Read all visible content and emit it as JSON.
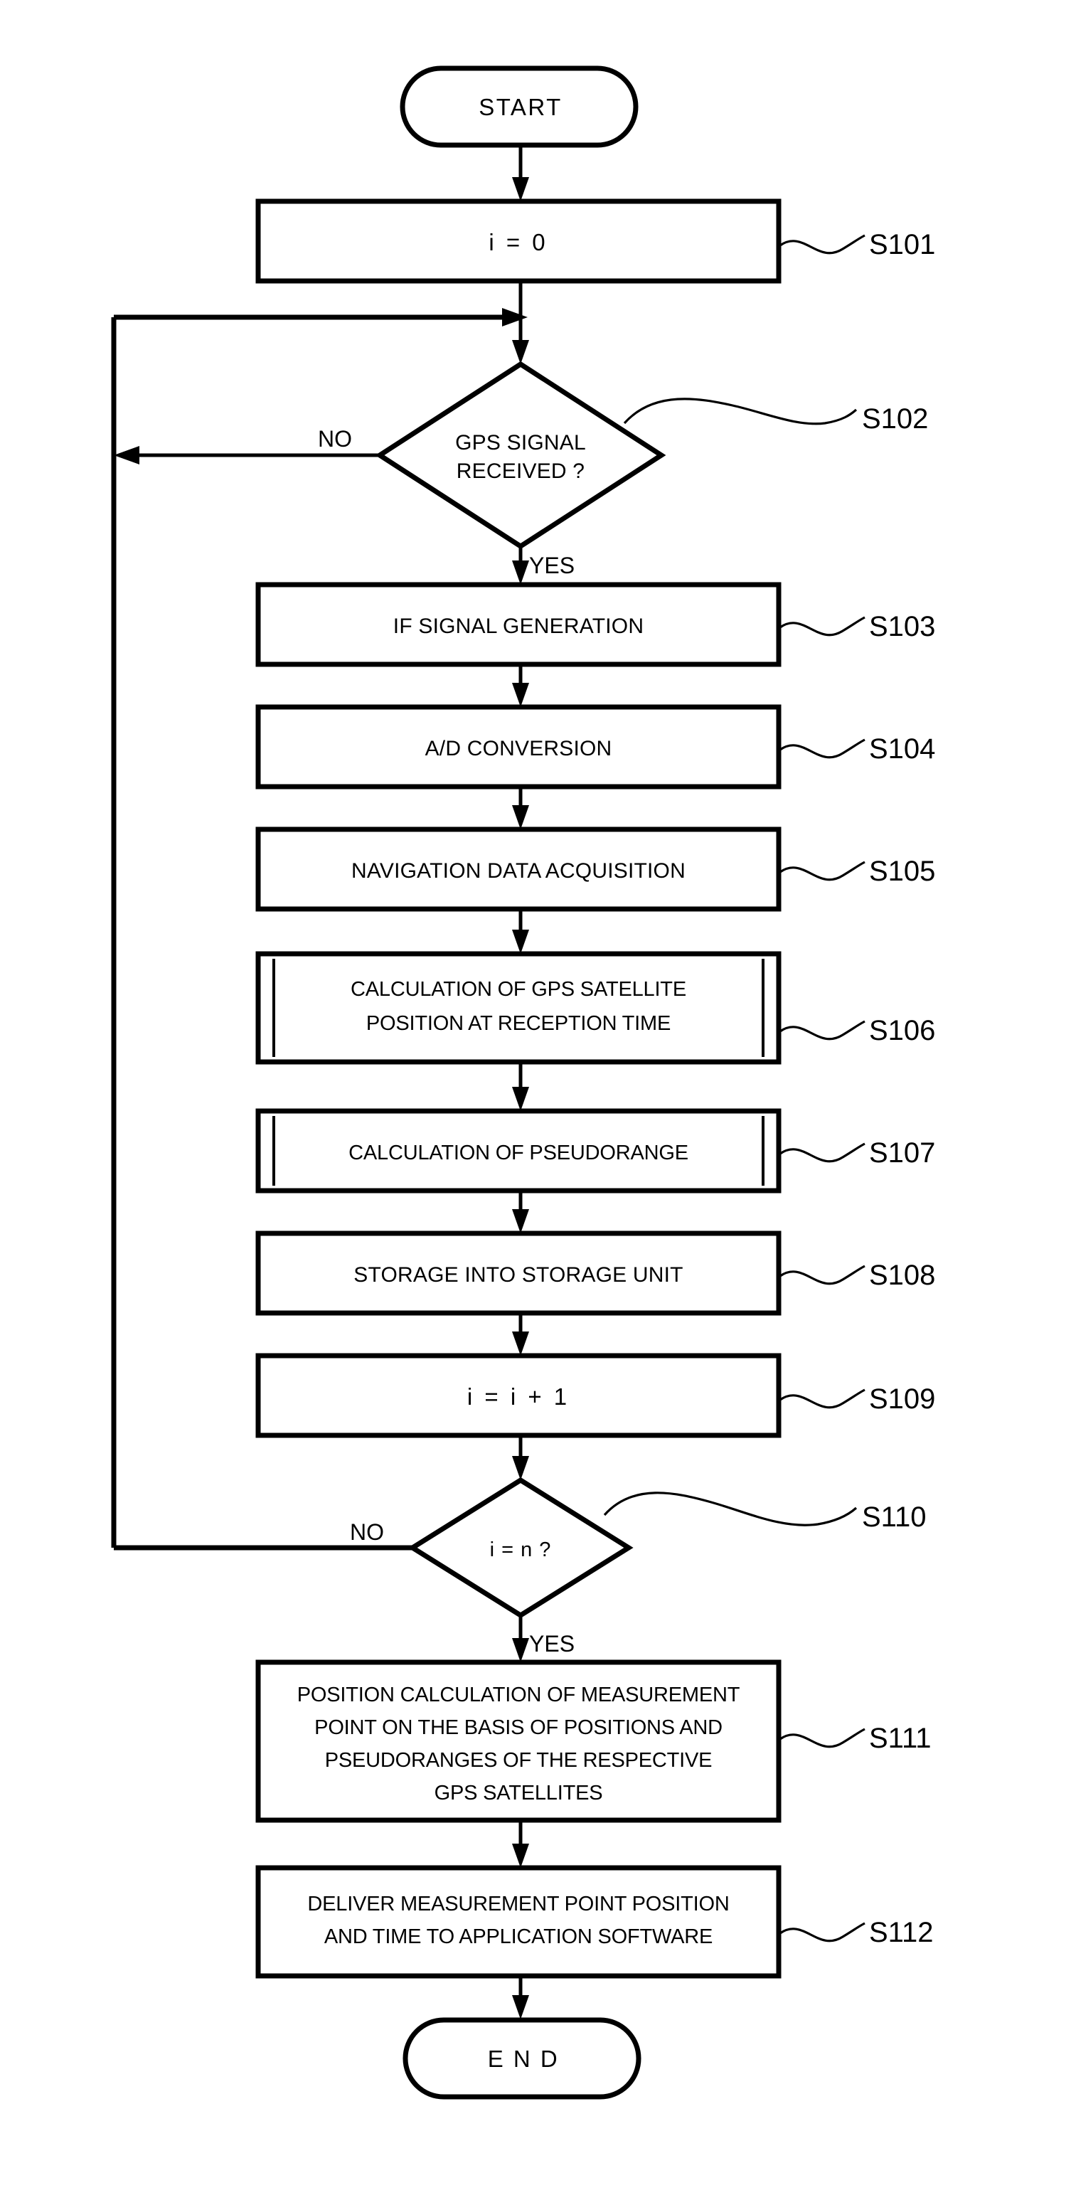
{
  "diagram": {
    "type": "flowchart",
    "title": "GPS positioning procedure flowchart",
    "orientation": "top-to-bottom",
    "background_color": "#ffffff",
    "line_color": "#000000",
    "nodes": {
      "start": {
        "shape": "terminal",
        "label": "START"
      },
      "s101": {
        "shape": "process",
        "label": "i  =  0",
        "step": "S101"
      },
      "s102": {
        "shape": "decision",
        "label_line1": "GPS SIGNAL",
        "label_line2": "RECEIVED ?",
        "step": "S102",
        "branch_no": "NO",
        "branch_yes": "YES"
      },
      "s103": {
        "shape": "process",
        "label": "IF SIGNAL GENERATION",
        "step": "S103"
      },
      "s104": {
        "shape": "process",
        "label": "A/D CONVERSION",
        "step": "S104"
      },
      "s105": {
        "shape": "process",
        "label": "NAVIGATION DATA ACQUISITION",
        "step": "S105"
      },
      "s106": {
        "shape": "predefined-process",
        "label_line1": "CALCULATION OF GPS SATELLITE",
        "label_line2": "POSITION AT RECEPTION TIME",
        "step": "S106"
      },
      "s107": {
        "shape": "predefined-process",
        "label": "CALCULATION OF PSEUDORANGE",
        "step": "S107"
      },
      "s108": {
        "shape": "process",
        "label": "STORAGE INTO STORAGE UNIT",
        "step": "S108"
      },
      "s109": {
        "shape": "process",
        "label": "i  =  i  +  1",
        "step": "S109"
      },
      "s110": {
        "shape": "decision",
        "label": "i = n ?",
        "step": "S110",
        "branch_no": "NO",
        "branch_yes": "YES"
      },
      "s111": {
        "shape": "process",
        "label_line1": "POSITION CALCULATION OF MEASUREMENT",
        "label_line2": "POINT ON THE BASIS OF POSITIONS AND",
        "label_line3": "PSEUDORANGES OF THE RESPECTIVE",
        "label_line4": "GPS SATELLITES",
        "step": "S111"
      },
      "s112": {
        "shape": "process",
        "label_line1": "DELIVER MEASUREMENT POINT POSITION",
        "label_line2": "AND TIME TO APPLICATION SOFTWARE",
        "step": "S112"
      },
      "end": {
        "shape": "terminal",
        "label": "E N D"
      }
    },
    "edges": [
      {
        "from": "start",
        "to": "s101",
        "label": ""
      },
      {
        "from": "s101",
        "to": "s102",
        "label": ""
      },
      {
        "from": "s102",
        "to": "s103",
        "label": "YES"
      },
      {
        "from": "s102",
        "to": "loop-return",
        "label": "NO"
      },
      {
        "from": "s103",
        "to": "s104",
        "label": ""
      },
      {
        "from": "s104",
        "to": "s105",
        "label": ""
      },
      {
        "from": "s105",
        "to": "s106",
        "label": ""
      },
      {
        "from": "s106",
        "to": "s107",
        "label": ""
      },
      {
        "from": "s107",
        "to": "s108",
        "label": ""
      },
      {
        "from": "s108",
        "to": "s109",
        "label": ""
      },
      {
        "from": "s109",
        "to": "s110",
        "label": ""
      },
      {
        "from": "s110",
        "to": "loop-return",
        "label": "NO"
      },
      {
        "from": "s110",
        "to": "s111",
        "label": "YES"
      },
      {
        "from": "s111",
        "to": "s112",
        "label": ""
      },
      {
        "from": "s112",
        "to": "end",
        "label": ""
      }
    ]
  }
}
